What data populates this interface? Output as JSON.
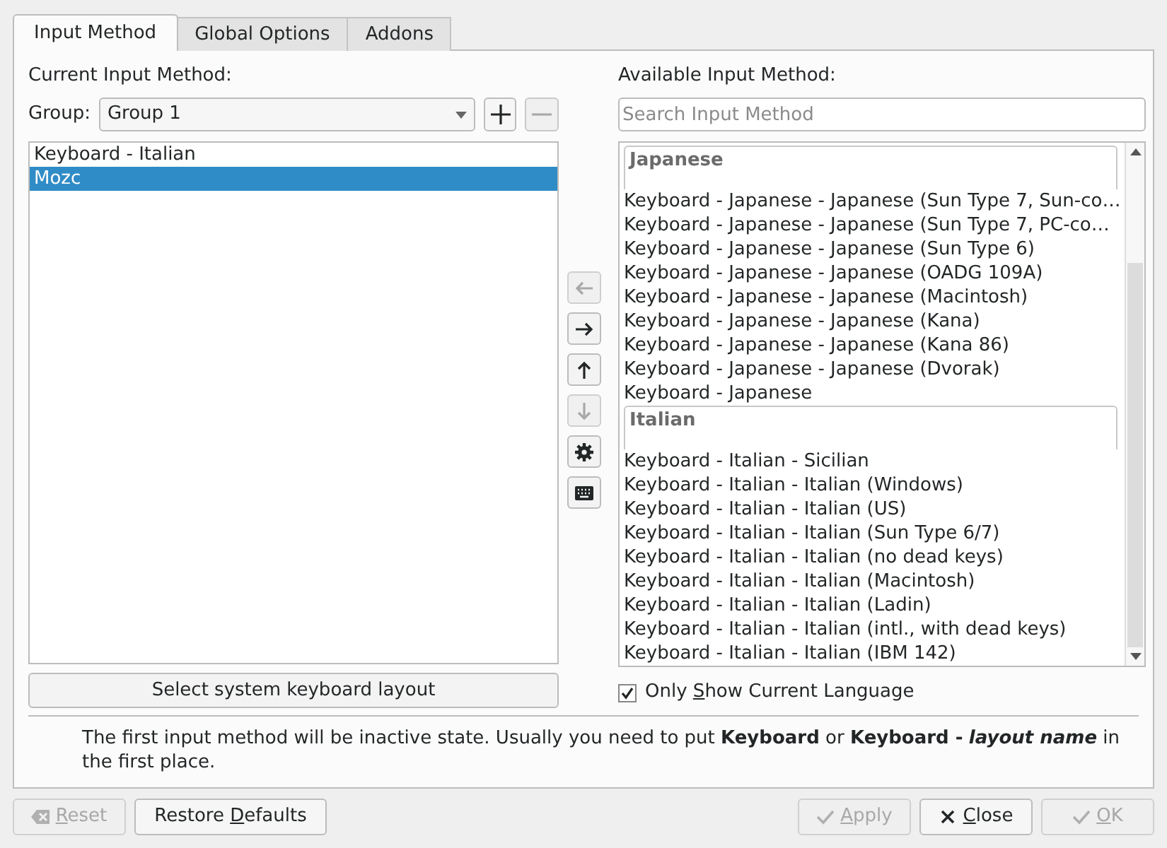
{
  "tabs": [
    {
      "label": "Input Method",
      "selected": true
    },
    {
      "label": "Global Options",
      "selected": false
    },
    {
      "label": "Addons",
      "selected": false
    }
  ],
  "current": {
    "title": "Current Input Method:",
    "group_label": "Group:",
    "group_value": "Group 1",
    "items": [
      {
        "label": "Keyboard - Italian",
        "selected": false
      },
      {
        "label": "Mozc",
        "selected": true
      }
    ],
    "system_button": "Select system keyboard layout"
  },
  "middle_buttons": [
    {
      "kind": "left",
      "disabled": true
    },
    {
      "kind": "right",
      "disabled": false
    },
    {
      "kind": "up",
      "disabled": false
    },
    {
      "kind": "down",
      "disabled": true
    },
    {
      "kind": "settings",
      "disabled": false
    },
    {
      "kind": "keyboard",
      "disabled": false
    }
  ],
  "available": {
    "title": "Available Input Method:",
    "search": {
      "placeholder": "Search Input Method"
    },
    "groups": [
      {
        "name": "Japanese",
        "items": [
          "Keyboard - Japanese - Japanese (Sun Type 7, Sun-co…",
          "Keyboard - Japanese - Japanese (Sun Type 7, PC-co…",
          "Keyboard - Japanese - Japanese (Sun Type 6)",
          "Keyboard - Japanese - Japanese (OADG 109A)",
          "Keyboard - Japanese - Japanese (Macintosh)",
          "Keyboard - Japanese - Japanese (Kana)",
          "Keyboard - Japanese - Japanese (Kana 86)",
          "Keyboard - Japanese - Japanese (Dvorak)",
          "Keyboard - Japanese"
        ]
      },
      {
        "name": "Italian",
        "items": [
          "Keyboard - Italian - Sicilian",
          "Keyboard - Italian - Italian (Windows)",
          "Keyboard - Italian - Italian (US)",
          "Keyboard - Italian - Italian (Sun Type 6/7)",
          "Keyboard - Italian - Italian (no dead keys)",
          "Keyboard - Italian - Italian (Macintosh)",
          "Keyboard - Italian - Italian (Ladin)",
          "Keyboard - Italian - Italian (intl., with dead keys)",
          "Keyboard - Italian - Italian (IBM 142)"
        ]
      }
    ],
    "only_current": {
      "label_start": "Only ",
      "mnemonic": "S",
      "label_rest": "how Current Language",
      "checked": true
    }
  },
  "note": "The first input method will be inactive state. Usually you need to put **Keyboard** or **Keyboard -** *layout name* in the first place.",
  "buttons": [
    {
      "kind": "reset",
      "mnemonic": "R",
      "label_rest": "eset",
      "disabled": true
    },
    {
      "kind": "plain",
      "label_start": "Restore ",
      "mnemonic": "D",
      "label_rest": "efaults",
      "disabled": false
    },
    {
      "kind": "apply",
      "mnemonic": "A",
      "label_rest": "pply",
      "disabled": true
    },
    {
      "kind": "close",
      "mnemonic": "C",
      "label_rest": "lose",
      "disabled": false
    },
    {
      "kind": "ok",
      "mnemonic": "O",
      "label_rest": "K",
      "disabled": true
    }
  ]
}
